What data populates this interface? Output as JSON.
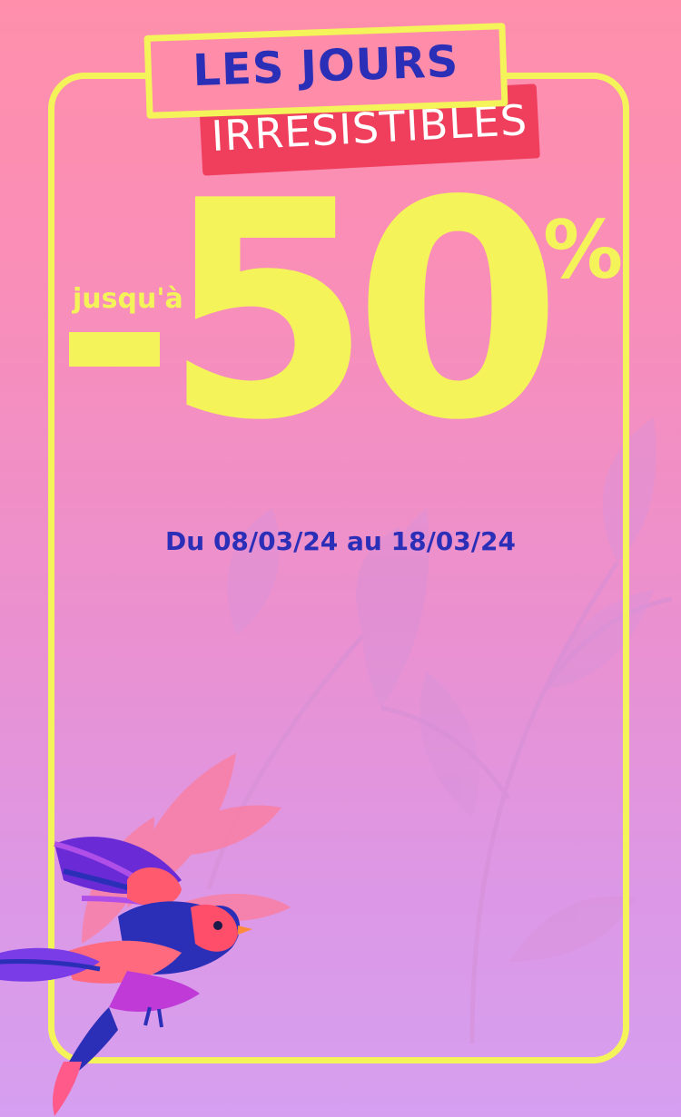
{
  "headline": {
    "line1": "LES JOURS",
    "line2": "IRRÉSISTIBLES"
  },
  "offer": {
    "prefix": "jusqu'à",
    "value": "50",
    "unit": "%"
  },
  "dates": "Du 08/03/24 au 18/03/24",
  "colors": {
    "accent_yellow": "#f4f45a",
    "title_blue": "#2b2fb8",
    "title_red": "#ef3f5c",
    "bg_top": "#ff8fab",
    "bg_bottom": "#d69ff0"
  },
  "decorations": [
    "leaves-illustration",
    "bird-illustration"
  ]
}
